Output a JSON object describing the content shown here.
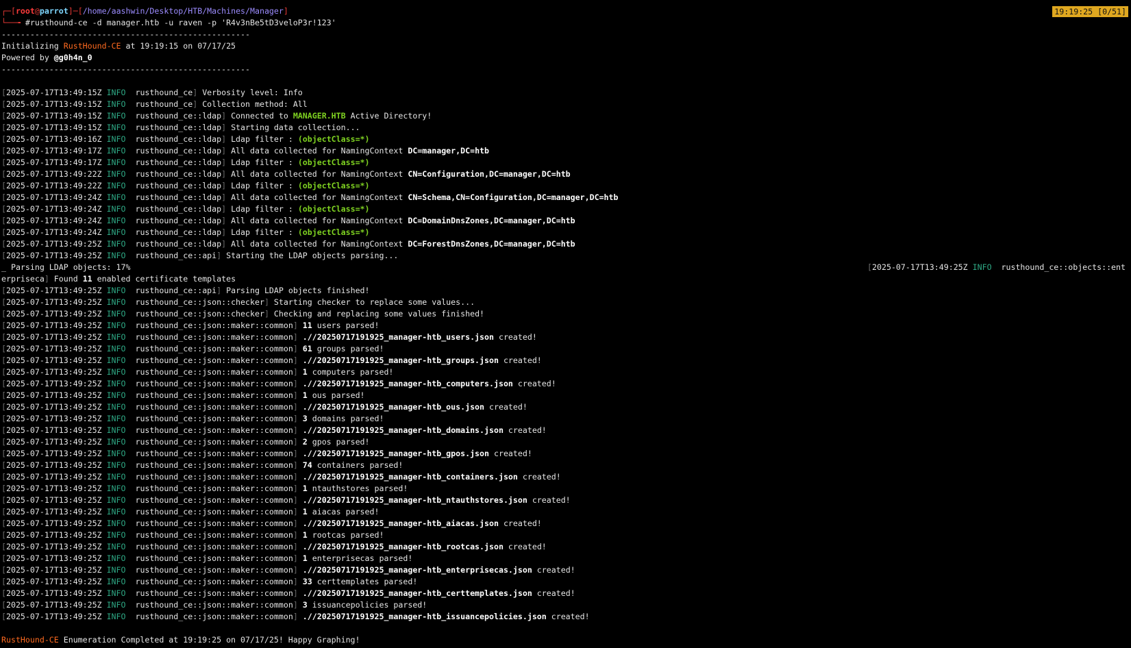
{
  "prompt": {
    "user": "root",
    "at": "@",
    "host": "parrot",
    "path": "/home/aashwin/Desktop/HTB/Machines/Manager",
    "command": "rusthound-ce -d manager.htb -u raven -p 'R4v3nBe5tD3veloP3r!123'"
  },
  "status_clock": "19:19:25 [0/51]",
  "separator": "----------------------------------------------------",
  "banner": {
    "init_prefix": "Initializing ",
    "tool": "RustHound-CE",
    "init_suffix": " at 19:19:15 on 07/17/25",
    "powered_prefix": "Powered by ",
    "powered_author": "@g0h4n_0"
  },
  "logs": [
    {
      "ts": "2025-07-17T13:49:15Z",
      "level": "INFO",
      "module": "rusthound_ce",
      "pre": "Verbosity level: Info",
      "hl": "",
      "post": "",
      "hl_style": ""
    },
    {
      "ts": "2025-07-17T13:49:15Z",
      "level": "INFO",
      "module": "rusthound_ce",
      "pre": "Collection method: All",
      "hl": "",
      "post": "",
      "hl_style": ""
    },
    {
      "ts": "2025-07-17T13:49:15Z",
      "level": "INFO",
      "module": "rusthound_ce::ldap",
      "pre": "Connected to ",
      "hl": "MANAGER.HTB",
      "post": " Active Directory!",
      "hl_style": "green"
    },
    {
      "ts": "2025-07-17T13:49:15Z",
      "level": "INFO",
      "module": "rusthound_ce::ldap",
      "pre": "Starting data collection...",
      "hl": "",
      "post": "",
      "hl_style": ""
    },
    {
      "ts": "2025-07-17T13:49:16Z",
      "level": "INFO",
      "module": "rusthound_ce::ldap",
      "pre": "Ldap filter : ",
      "hl": "(objectClass=*)",
      "post": "",
      "hl_style": "green"
    },
    {
      "ts": "2025-07-17T13:49:17Z",
      "level": "INFO",
      "module": "rusthound_ce::ldap",
      "pre": "All data collected for NamingContext ",
      "hl": "DC=manager,DC=htb",
      "post": "",
      "hl_style": "bold"
    },
    {
      "ts": "2025-07-17T13:49:17Z",
      "level": "INFO",
      "module": "rusthound_ce::ldap",
      "pre": "Ldap filter : ",
      "hl": "(objectClass=*)",
      "post": "",
      "hl_style": "green"
    },
    {
      "ts": "2025-07-17T13:49:22Z",
      "level": "INFO",
      "module": "rusthound_ce::ldap",
      "pre": "All data collected for NamingContext ",
      "hl": "CN=Configuration,DC=manager,DC=htb",
      "post": "",
      "hl_style": "bold"
    },
    {
      "ts": "2025-07-17T13:49:22Z",
      "level": "INFO",
      "module": "rusthound_ce::ldap",
      "pre": "Ldap filter : ",
      "hl": "(objectClass=*)",
      "post": "",
      "hl_style": "green"
    },
    {
      "ts": "2025-07-17T13:49:24Z",
      "level": "INFO",
      "module": "rusthound_ce::ldap",
      "pre": "All data collected for NamingContext ",
      "hl": "CN=Schema,CN=Configuration,DC=manager,DC=htb",
      "post": "",
      "hl_style": "bold"
    },
    {
      "ts": "2025-07-17T13:49:24Z",
      "level": "INFO",
      "module": "rusthound_ce::ldap",
      "pre": "Ldap filter : ",
      "hl": "(objectClass=*)",
      "post": "",
      "hl_style": "green"
    },
    {
      "ts": "2025-07-17T13:49:24Z",
      "level": "INFO",
      "module": "rusthound_ce::ldap",
      "pre": "All data collected for NamingContext ",
      "hl": "DC=DomainDnsZones,DC=manager,DC=htb",
      "post": "",
      "hl_style": "bold"
    },
    {
      "ts": "2025-07-17T13:49:24Z",
      "level": "INFO",
      "module": "rusthound_ce::ldap",
      "pre": "Ldap filter : ",
      "hl": "(objectClass=*)",
      "post": "",
      "hl_style": "green"
    },
    {
      "ts": "2025-07-17T13:49:25Z",
      "level": "INFO",
      "module": "rusthound_ce::ldap",
      "pre": "All data collected for NamingContext ",
      "hl": "DC=ForestDnsZones,DC=manager,DC=htb",
      "post": "",
      "hl_style": "bold"
    },
    {
      "ts": "2025-07-17T13:49:25Z",
      "level": "INFO",
      "module": "rusthound_ce::api",
      "pre": "Starting the LDAP objects parsing...",
      "hl": "",
      "post": "",
      "hl_style": ""
    }
  ],
  "progress": {
    "text": "_ Parsing LDAP objects: 17%",
    "right_open": "[",
    "right_ts": "2025-07-17T13:49:25Z",
    "right_level": "INFO",
    "right_module": "rusthound_ce::objects::ent",
    "wrap_module": "erpriseca",
    "wrap_close": "]",
    "wrap_pre": " Found ",
    "wrap_hl": "11",
    "wrap_post": " enabled certificate templates"
  },
  "logs2": [
    {
      "ts": "2025-07-17T13:49:25Z",
      "level": "INFO",
      "module": "rusthound_ce::api",
      "pre": "Parsing LDAP objects finished!",
      "hl": "",
      "post": "",
      "hl_style": ""
    },
    {
      "ts": "2025-07-17T13:49:25Z",
      "level": "INFO",
      "module": "rusthound_ce::json::checker",
      "pre": "Starting checker to replace some values...",
      "hl": "",
      "post": "",
      "hl_style": ""
    },
    {
      "ts": "2025-07-17T13:49:25Z",
      "level": "INFO",
      "module": "rusthound_ce::json::checker",
      "pre": "Checking and replacing some values finished!",
      "hl": "",
      "post": "",
      "hl_style": ""
    },
    {
      "ts": "2025-07-17T13:49:25Z",
      "level": "INFO",
      "module": "rusthound_ce::json::maker::common",
      "pre": "",
      "hl": "11",
      "post": " users parsed!",
      "hl_style": "bold"
    },
    {
      "ts": "2025-07-17T13:49:25Z",
      "level": "INFO",
      "module": "rusthound_ce::json::maker::common",
      "pre": "",
      "hl": ".//20250717191925_manager-htb_users.json",
      "post": " created!",
      "hl_style": "bold"
    },
    {
      "ts": "2025-07-17T13:49:25Z",
      "level": "INFO",
      "module": "rusthound_ce::json::maker::common",
      "pre": "",
      "hl": "61",
      "post": " groups parsed!",
      "hl_style": "bold"
    },
    {
      "ts": "2025-07-17T13:49:25Z",
      "level": "INFO",
      "module": "rusthound_ce::json::maker::common",
      "pre": "",
      "hl": ".//20250717191925_manager-htb_groups.json",
      "post": " created!",
      "hl_style": "bold"
    },
    {
      "ts": "2025-07-17T13:49:25Z",
      "level": "INFO",
      "module": "rusthound_ce::json::maker::common",
      "pre": "",
      "hl": "1",
      "post": " computers parsed!",
      "hl_style": "bold"
    },
    {
      "ts": "2025-07-17T13:49:25Z",
      "level": "INFO",
      "module": "rusthound_ce::json::maker::common",
      "pre": "",
      "hl": ".//20250717191925_manager-htb_computers.json",
      "post": " created!",
      "hl_style": "bold"
    },
    {
      "ts": "2025-07-17T13:49:25Z",
      "level": "INFO",
      "module": "rusthound_ce::json::maker::common",
      "pre": "",
      "hl": "1",
      "post": " ous parsed!",
      "hl_style": "bold"
    },
    {
      "ts": "2025-07-17T13:49:25Z",
      "level": "INFO",
      "module": "rusthound_ce::json::maker::common",
      "pre": "",
      "hl": ".//20250717191925_manager-htb_ous.json",
      "post": " created!",
      "hl_style": "bold"
    },
    {
      "ts": "2025-07-17T13:49:25Z",
      "level": "INFO",
      "module": "rusthound_ce::json::maker::common",
      "pre": "",
      "hl": "3",
      "post": " domains parsed!",
      "hl_style": "bold"
    },
    {
      "ts": "2025-07-17T13:49:25Z",
      "level": "INFO",
      "module": "rusthound_ce::json::maker::common",
      "pre": "",
      "hl": ".//20250717191925_manager-htb_domains.json",
      "post": " created!",
      "hl_style": "bold"
    },
    {
      "ts": "2025-07-17T13:49:25Z",
      "level": "INFO",
      "module": "rusthound_ce::json::maker::common",
      "pre": "",
      "hl": "2",
      "post": " gpos parsed!",
      "hl_style": "bold"
    },
    {
      "ts": "2025-07-17T13:49:25Z",
      "level": "INFO",
      "module": "rusthound_ce::json::maker::common",
      "pre": "",
      "hl": ".//20250717191925_manager-htb_gpos.json",
      "post": " created!",
      "hl_style": "bold"
    },
    {
      "ts": "2025-07-17T13:49:25Z",
      "level": "INFO",
      "module": "rusthound_ce::json::maker::common",
      "pre": "",
      "hl": "74",
      "post": " containers parsed!",
      "hl_style": "bold"
    },
    {
      "ts": "2025-07-17T13:49:25Z",
      "level": "INFO",
      "module": "rusthound_ce::json::maker::common",
      "pre": "",
      "hl": ".//20250717191925_manager-htb_containers.json",
      "post": " created!",
      "hl_style": "bold"
    },
    {
      "ts": "2025-07-17T13:49:25Z",
      "level": "INFO",
      "module": "rusthound_ce::json::maker::common",
      "pre": "",
      "hl": "1",
      "post": " ntauthstores parsed!",
      "hl_style": "bold"
    },
    {
      "ts": "2025-07-17T13:49:25Z",
      "level": "INFO",
      "module": "rusthound_ce::json::maker::common",
      "pre": "",
      "hl": ".//20250717191925_manager-htb_ntauthstores.json",
      "post": " created!",
      "hl_style": "bold"
    },
    {
      "ts": "2025-07-17T13:49:25Z",
      "level": "INFO",
      "module": "rusthound_ce::json::maker::common",
      "pre": "",
      "hl": "1",
      "post": " aiacas parsed!",
      "hl_style": "bold"
    },
    {
      "ts": "2025-07-17T13:49:25Z",
      "level": "INFO",
      "module": "rusthound_ce::json::maker::common",
      "pre": "",
      "hl": ".//20250717191925_manager-htb_aiacas.json",
      "post": " created!",
      "hl_style": "bold"
    },
    {
      "ts": "2025-07-17T13:49:25Z",
      "level": "INFO",
      "module": "rusthound_ce::json::maker::common",
      "pre": "",
      "hl": "1",
      "post": " rootcas parsed!",
      "hl_style": "bold"
    },
    {
      "ts": "2025-07-17T13:49:25Z",
      "level": "INFO",
      "module": "rusthound_ce::json::maker::common",
      "pre": "",
      "hl": ".//20250717191925_manager-htb_rootcas.json",
      "post": " created!",
      "hl_style": "bold"
    },
    {
      "ts": "2025-07-17T13:49:25Z",
      "level": "INFO",
      "module": "rusthound_ce::json::maker::common",
      "pre": "",
      "hl": "1",
      "post": " enterprisecas parsed!",
      "hl_style": "bold"
    },
    {
      "ts": "2025-07-17T13:49:25Z",
      "level": "INFO",
      "module": "rusthound_ce::json::maker::common",
      "pre": "",
      "hl": ".//20250717191925_manager-htb_enterprisecas.json",
      "post": " created!",
      "hl_style": "bold"
    },
    {
      "ts": "2025-07-17T13:49:25Z",
      "level": "INFO",
      "module": "rusthound_ce::json::maker::common",
      "pre": "",
      "hl": "33",
      "post": " certtemplates parsed!",
      "hl_style": "bold"
    },
    {
      "ts": "2025-07-17T13:49:25Z",
      "level": "INFO",
      "module": "rusthound_ce::json::maker::common",
      "pre": "",
      "hl": ".//20250717191925_manager-htb_certtemplates.json",
      "post": " created!",
      "hl_style": "bold"
    },
    {
      "ts": "2025-07-17T13:49:25Z",
      "level": "INFO",
      "module": "rusthound_ce::json::maker::common",
      "pre": "",
      "hl": "3",
      "post": " issuancepolicies parsed!",
      "hl_style": "bold"
    },
    {
      "ts": "2025-07-17T13:49:25Z",
      "level": "INFO",
      "module": "rusthound_ce::json::maker::common",
      "pre": "",
      "hl": ".//20250717191925_manager-htb_issuancepolicies.json",
      "post": " created!",
      "hl_style": "bold"
    }
  ],
  "footer": {
    "tool": "RustHound-CE",
    "text": " Enumeration Completed at 19:19:25 on 07/17/25! Happy Graphing!"
  },
  "colors": {
    "background": "#000000",
    "prompt_user": "#ff3b3b",
    "prompt_host": "#7fd7ff",
    "path": "#9c8cff",
    "tool_name": "#ff6a1f",
    "highlight_green": "#7fd321",
    "info_level": "#2ea884",
    "status_clock": "#e0a820"
  }
}
